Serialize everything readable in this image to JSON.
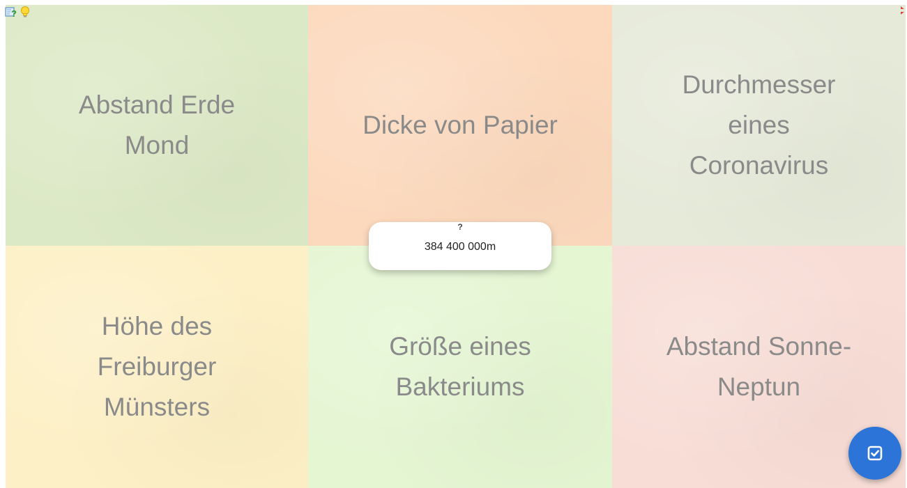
{
  "cells": [
    {
      "label": "Abstand Erde\nMond"
    },
    {
      "label": "Dicke von Papier"
    },
    {
      "label": "Durchmesser\neines\nCoronavirus"
    },
    {
      "label": "Höhe des\nFreiburger\nMünsters"
    },
    {
      "label": "Größe eines\nBakteriums"
    },
    {
      "label": "Abstand Sonne-\nNeptun"
    }
  ],
  "card": {
    "hint": "?",
    "value": "384 400 000m"
  },
  "icons": {
    "top_left": [
      "help-icon",
      "hint-lightbulb-icon"
    ],
    "top_right": "fullscreen-icon",
    "check": "check-icon"
  },
  "colors": {
    "accent": "#2d74d8",
    "text": "#8a8a8a",
    "cells": [
      "#dce9c6",
      "#fcd9bd",
      "#e6ead9",
      "#fdf0c6",
      "#e5f6d3",
      "#f8ddd6"
    ]
  }
}
